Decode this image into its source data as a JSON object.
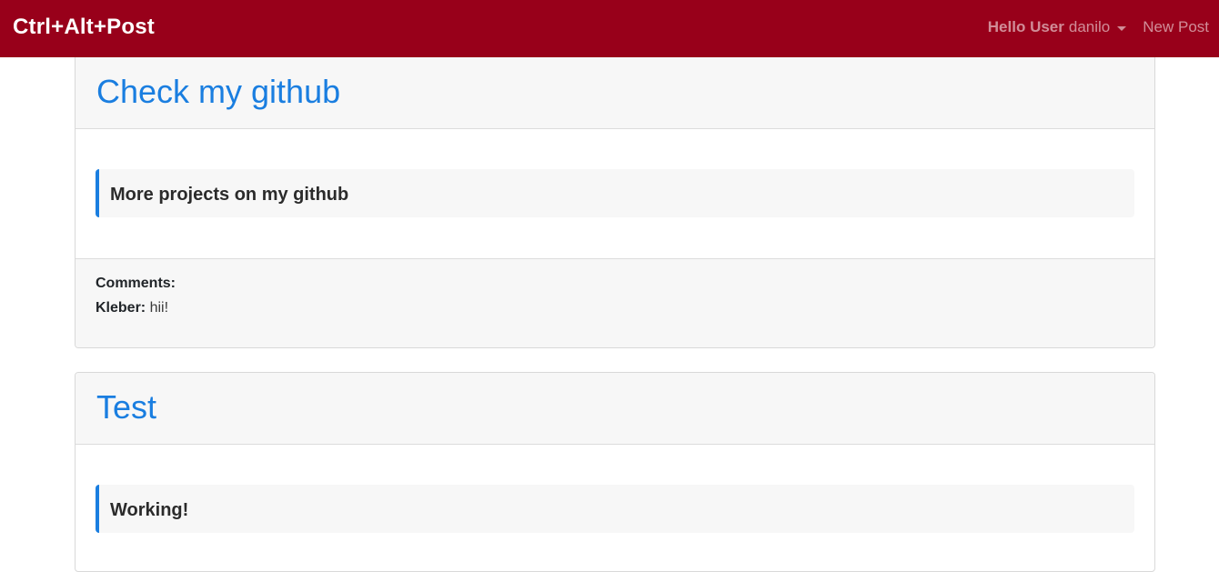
{
  "navbar": {
    "brand": "Ctrl+Alt+Post",
    "greeting": "Hello User",
    "username": "danilo",
    "new_post": "New Post",
    "background": "#98001a"
  },
  "posts": [
    {
      "title": "Check my github",
      "body": "More projects on my github",
      "comments_label": "Comments:",
      "comments": [
        {
          "author": "Kleber:",
          "text": "hii!"
        }
      ]
    },
    {
      "title": "Test",
      "body": "Working!"
    }
  ],
  "colors": {
    "accent": "#1a7ee0",
    "card_bg": "#f7f7f7"
  }
}
